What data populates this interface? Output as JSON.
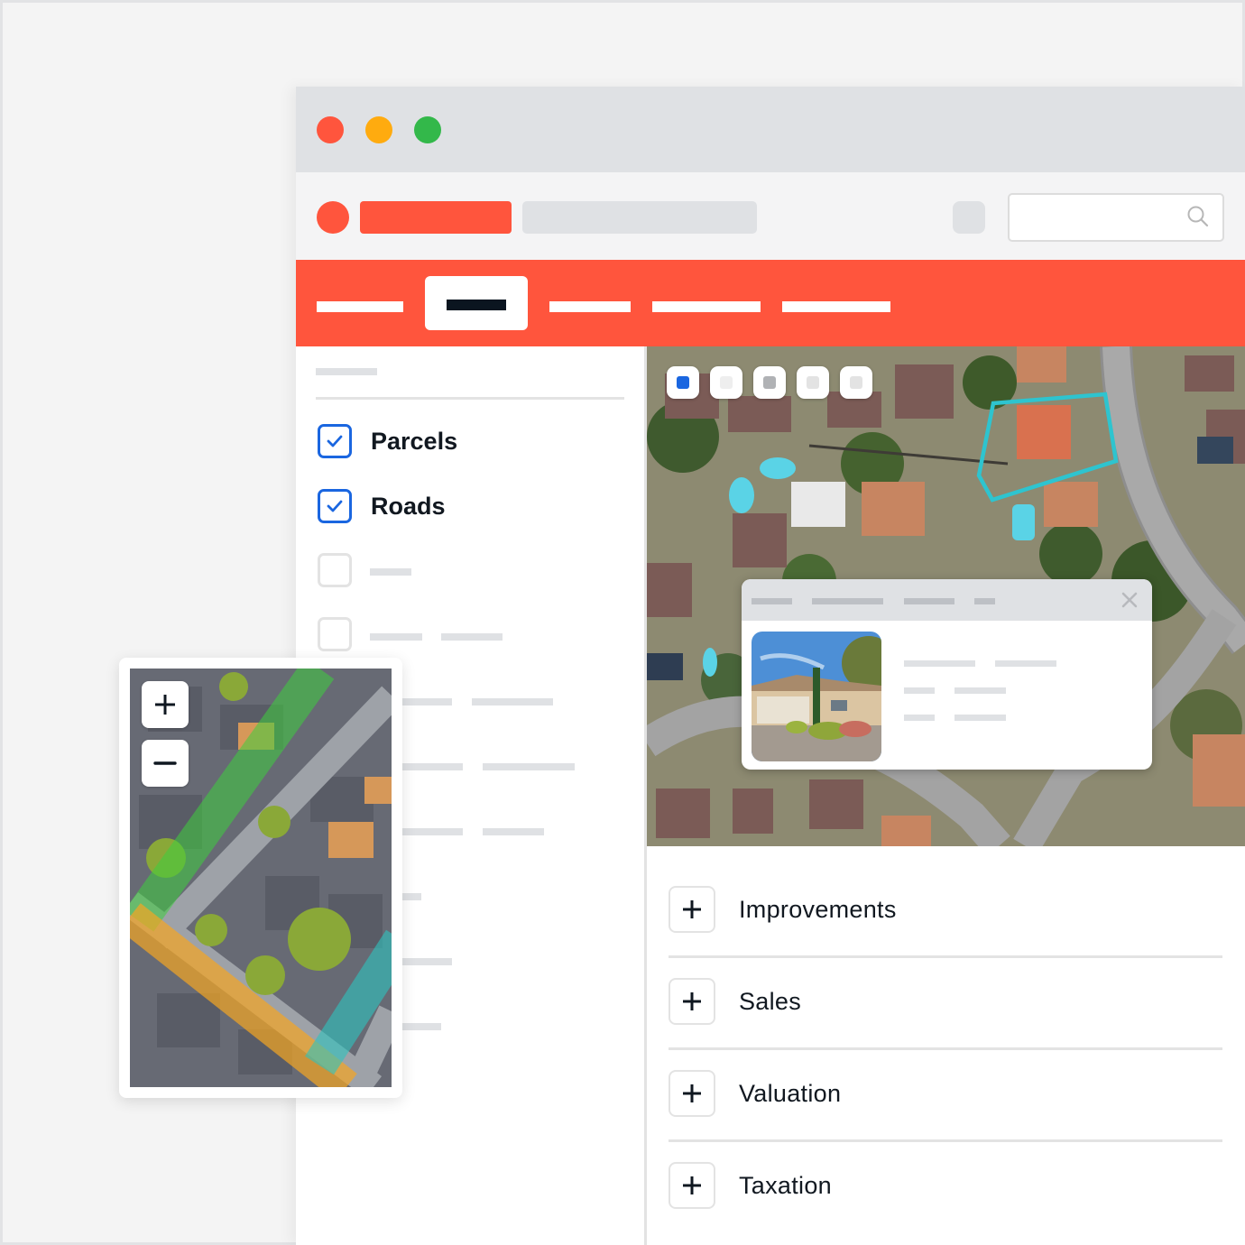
{
  "window": {
    "controls": [
      "close",
      "minimize",
      "maximize"
    ],
    "control_colors": {
      "close": "#ff553d",
      "minimize": "#ffab0f",
      "maximize": "#33b84a"
    }
  },
  "toolbar": {
    "search": {
      "placeholder": "",
      "value": "",
      "icon": "search-icon"
    }
  },
  "navbar": {
    "accent": "#ff553d",
    "tabs": [
      {
        "label": "",
        "active": false
      },
      {
        "label": "",
        "active": true
      },
      {
        "label": "",
        "active": false
      },
      {
        "label": "",
        "active": false
      },
      {
        "label": "",
        "active": false
      }
    ]
  },
  "sidebar": {
    "layers": [
      {
        "label": "Parcels",
        "checked": true
      },
      {
        "label": "Roads",
        "checked": true
      },
      {
        "label": "",
        "checked": false
      },
      {
        "label": "",
        "checked": false
      }
    ],
    "checkbox_color": "#1a66e0"
  },
  "map": {
    "layer_buttons": [
      {
        "name": "layer-1",
        "active": true,
        "color": "#1a66e0"
      },
      {
        "name": "layer-2",
        "active": false,
        "color": "#eeeeee"
      },
      {
        "name": "layer-3",
        "active": false,
        "color": "#b0b2b5"
      },
      {
        "name": "layer-4",
        "active": false,
        "color": "#e3e3e3"
      },
      {
        "name": "layer-5",
        "active": false,
        "color": "#e3e3e3"
      }
    ],
    "parcel_outline_color": "#2ec4cf",
    "popup": {
      "close_icon": "close-icon",
      "photo": "house-photo"
    }
  },
  "details": {
    "sections": [
      {
        "label": "Improvements"
      },
      {
        "label": "Sales"
      },
      {
        "label": "Valuation"
      },
      {
        "label": "Taxation"
      }
    ]
  },
  "minimap": {
    "zoom_in_label": "+",
    "zoom_out_label": "−",
    "road_overlays": {
      "green": "#3ecf3e",
      "amber": "#f5a623",
      "teal": "#2ec4bf"
    }
  }
}
